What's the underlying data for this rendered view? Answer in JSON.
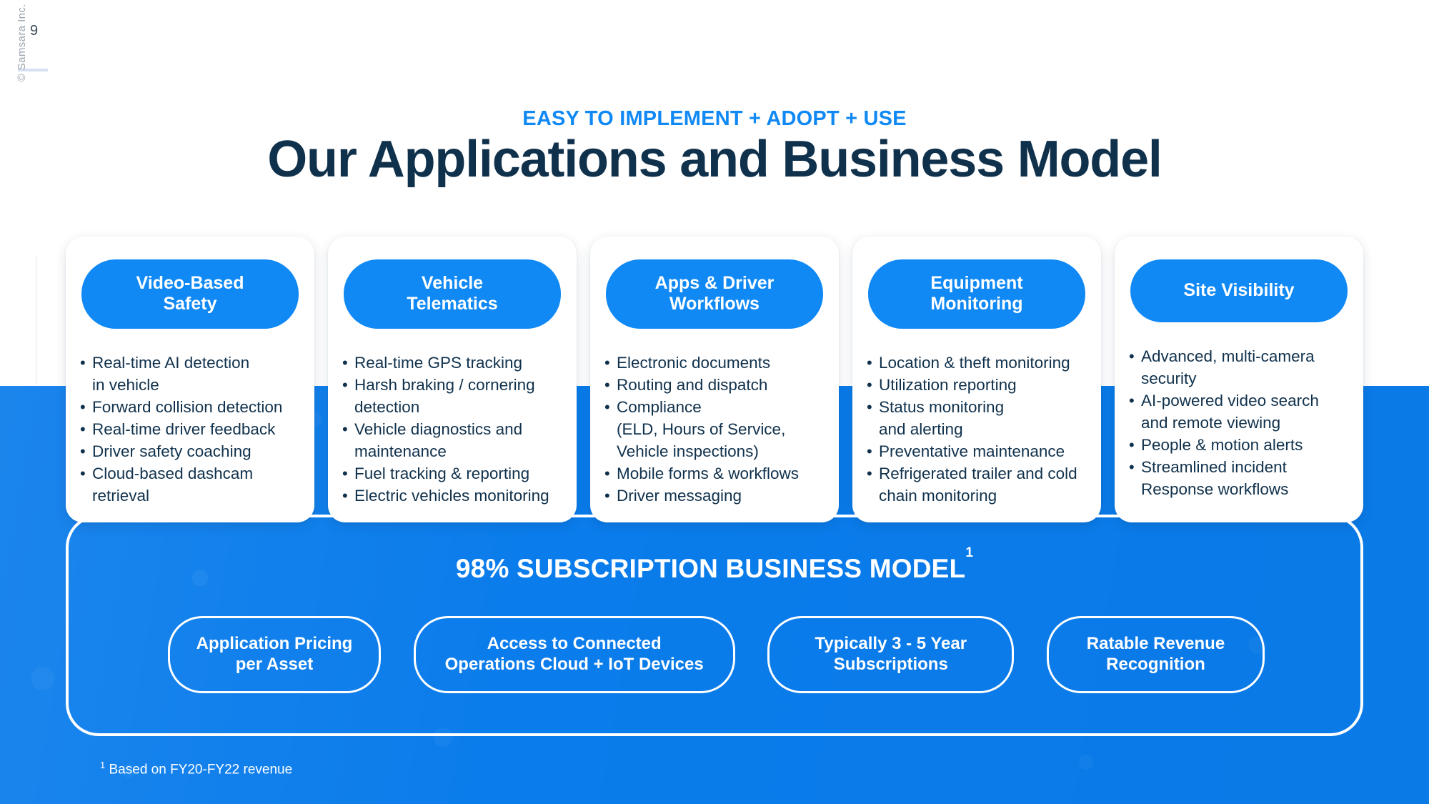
{
  "slide": {
    "page_number": "9",
    "confidential": "© Samsara Inc. Confidential."
  },
  "header": {
    "eyebrow": "EASY TO IMPLEMENT + ADOPT + USE",
    "title": "Our Applications and Business Model"
  },
  "cards": [
    {
      "title": "Video-Based\nSafety",
      "bullets": [
        "Real-time AI detection\n in vehicle",
        "Forward collision detection",
        "Real-time driver feedback",
        "Driver safety coaching",
        "Cloud-based dashcam retrieval"
      ]
    },
    {
      "title": "Vehicle\nTelematics",
      "bullets": [
        "Real-time GPS tracking",
        "Harsh braking / cornering\n detection",
        "Vehicle diagnostics and\n maintenance",
        "Fuel tracking & reporting",
        "Electric vehicles monitoring"
      ]
    },
    {
      "title": "Apps & Driver\nWorkflows",
      "bullets": [
        "Electronic documents",
        "Routing and dispatch",
        "Compliance\n (ELD, Hours of Service,\n Vehicle inspections)",
        "Mobile forms & workflows",
        "Driver messaging"
      ]
    },
    {
      "title": "Equipment\nMonitoring",
      "bullets": [
        "Location & theft monitoring",
        "Utilization reporting",
        "Status monitoring\n and alerting",
        "Preventative maintenance",
        "Refrigerated trailer and cold\n chain monitoring"
      ]
    },
    {
      "title": "Site Visibility",
      "bullets": [
        "Advanced, multi-camera\n security",
        "AI-powered video search\n and remote viewing",
        "People & motion alerts",
        "Streamlined incident\n Response workflows"
      ]
    }
  ],
  "subscription": {
    "title": "98% SUBSCRIPTION BUSINESS MODEL",
    "title_sup": "1",
    "pills": [
      "Application Pricing\nper Asset",
      "Access to Connected\nOperations Cloud + IoT Devices",
      "Typically 3 - 5 Year\nSubscriptions",
      "Ratable Revenue\nRecognition"
    ],
    "footnote_sup": "1",
    "footnote": " Based on FY20-FY22 revenue"
  },
  "colors": {
    "brand_blue": "#1089F5",
    "panel_blue": "#0A7CEB",
    "ink": "#10314C"
  }
}
